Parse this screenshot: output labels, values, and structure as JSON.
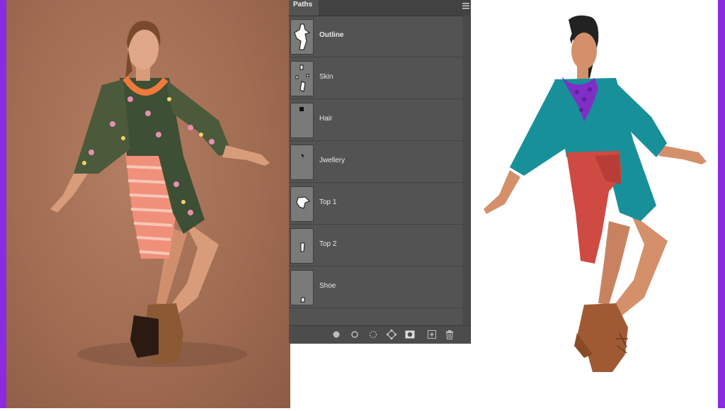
{
  "panel": {
    "tab_label": "Paths",
    "menu_icon": "panel-menu-icon",
    "paths": [
      {
        "label": "Outline",
        "selected": true
      },
      {
        "label": "Skin"
      },
      {
        "label": "Hair"
      },
      {
        "label": "Jwellery"
      },
      {
        "label": "Top 1"
      },
      {
        "label": "Top 2"
      },
      {
        "label": "Shoe"
      }
    ],
    "footer_icons": [
      "fill-path-icon",
      "stroke-path-icon",
      "load-selection-icon",
      "make-work-path-icon",
      "add-mask-icon",
      "new-path-icon",
      "delete-path-icon"
    ]
  },
  "colors": {
    "frame": "#8a2be2",
    "photo_background": "#a06c52",
    "panel_background": "#535353",
    "skin": "#d4906a",
    "top_teal": "#17909a",
    "tied_red": "#cf4a43",
    "jewellery_purple": "#7f2fc6",
    "shoe_brown": "#a05a33",
    "hair": "#222222"
  }
}
